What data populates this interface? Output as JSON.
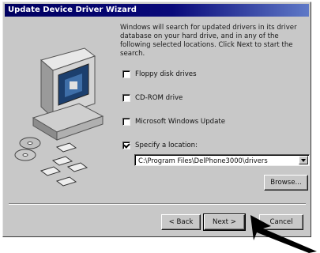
{
  "window": {
    "title": "Update Device Driver Wizard"
  },
  "instructions": "Windows will search for updated drivers in its driver database on your hard drive, and in any of the following selected locations. Click Next to start the search.",
  "options": [
    {
      "label": "Floppy disk drives",
      "checked": false
    },
    {
      "label": "CD-ROM drive",
      "checked": false
    },
    {
      "label": "Microsoft Windows Update",
      "checked": false
    },
    {
      "label": "Specify a location:",
      "checked": true
    }
  ],
  "location": {
    "value": "C:\\Program Files\\DelPhone3000\\drivers"
  },
  "buttons": {
    "browse": "Browse...",
    "back": "< Back",
    "next": "Next >",
    "cancel": "Cancel"
  }
}
